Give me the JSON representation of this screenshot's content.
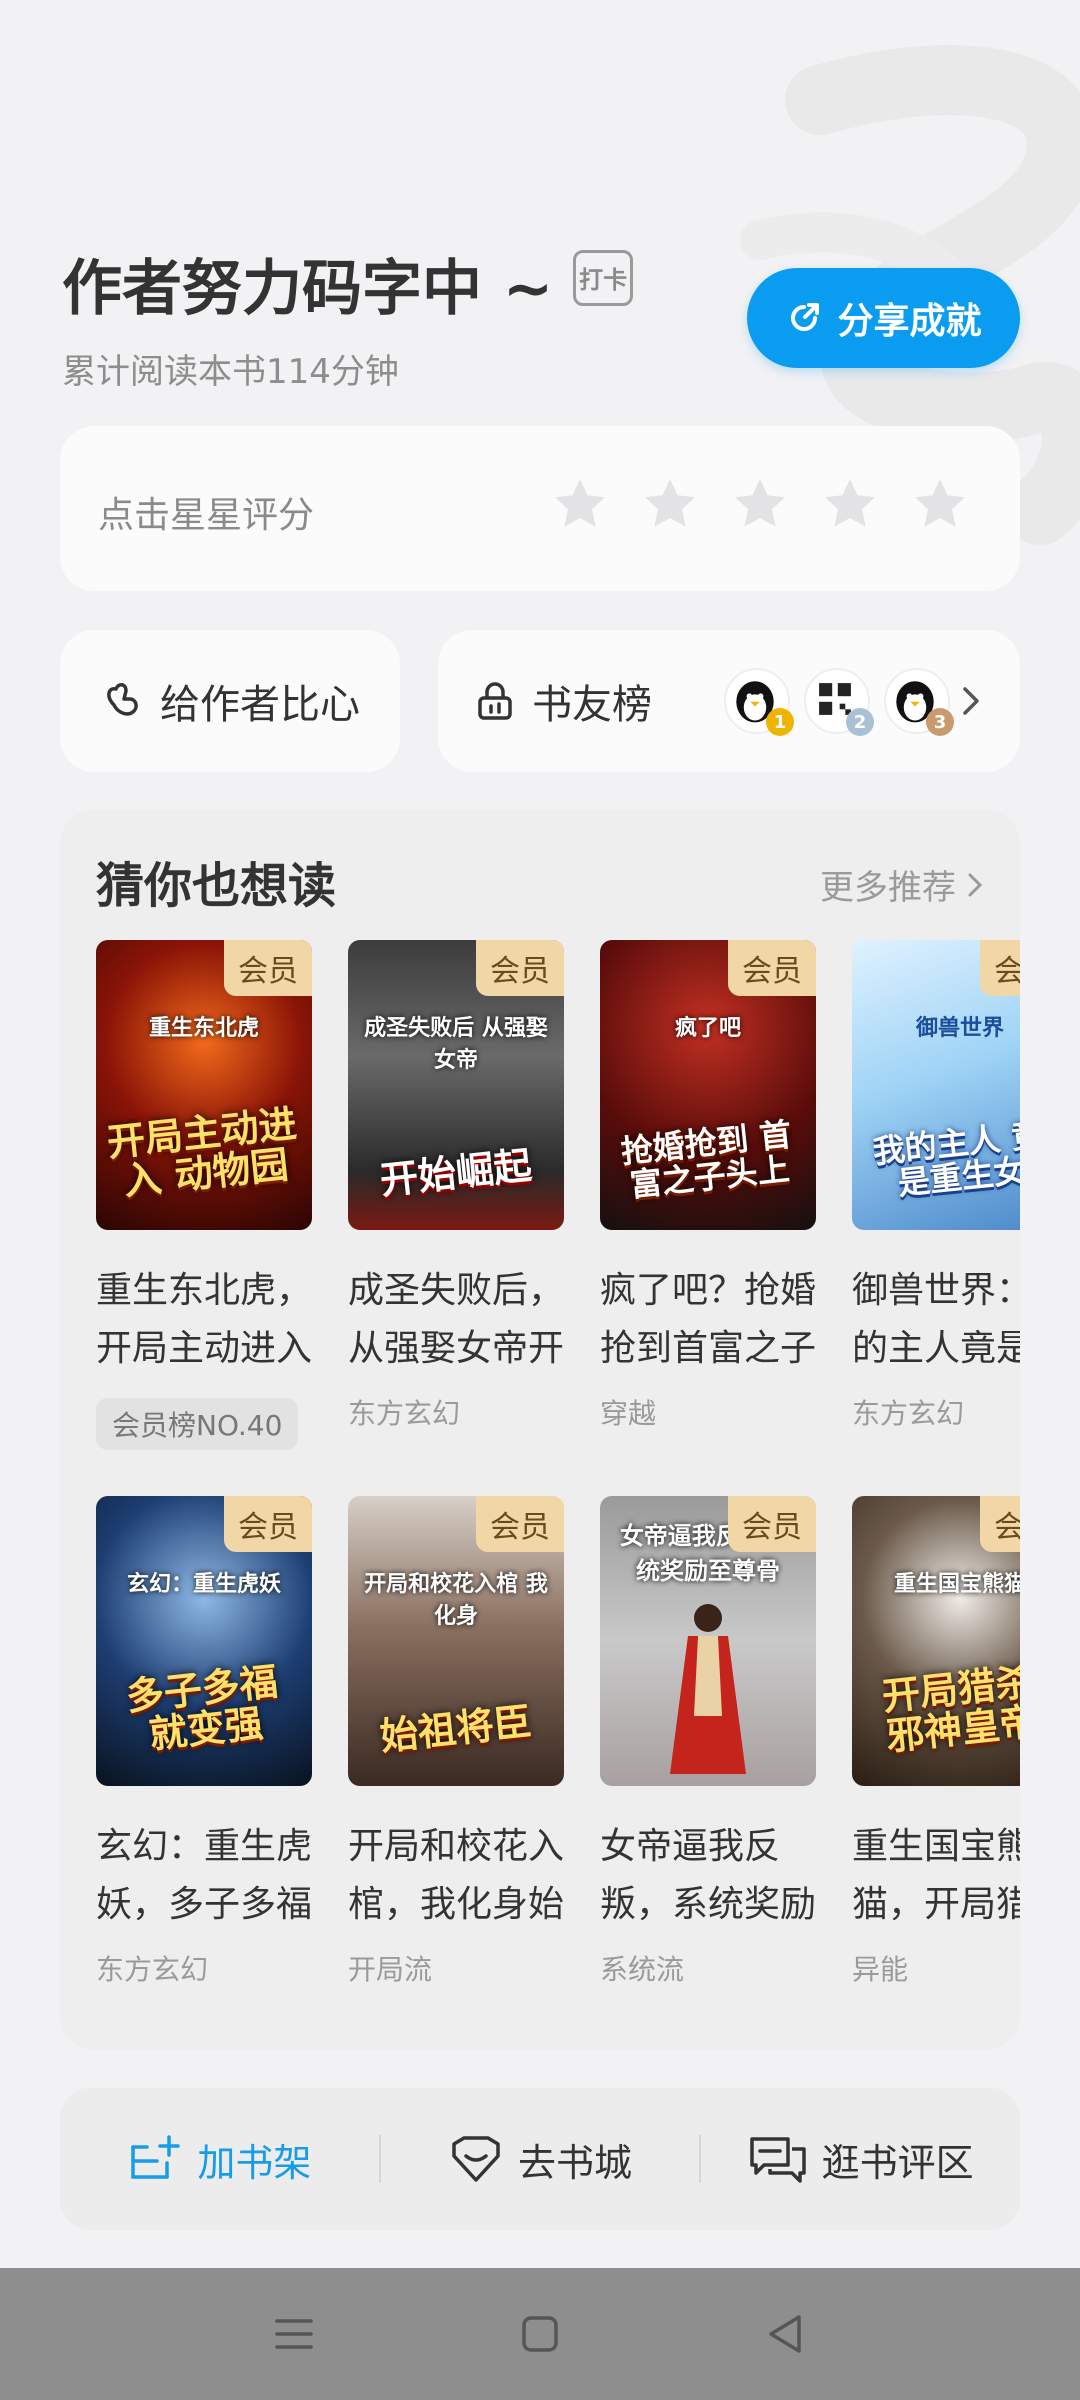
{
  "header": {
    "title": "作者努力码字中 ~",
    "checkin_label": "打卡",
    "subtitle": "累计阅读本书114分钟",
    "share_label": "分享成就"
  },
  "rating": {
    "label": "点击星星评分",
    "stars": 5
  },
  "tip": {
    "label": "给作者比心"
  },
  "friends": {
    "label": "书友榜",
    "ranks": [
      "1",
      "2",
      "3"
    ]
  },
  "recommend": {
    "title": "猜你也想读",
    "more": "更多推荐",
    "vip_label": "会员",
    "books": [
      {
        "cover_title": "开局主动进入\n动物园",
        "cover_sub": "重生东北虎",
        "title": "重生东北虎，\n开局主动进入",
        "tag": "会员榜NO.40"
      },
      {
        "cover_title": "开始崛起",
        "cover_sub": "成圣失败后 从强娶女帝",
        "title": "成圣失败后，\n从强娶女帝开",
        "tag": "东方玄幻"
      },
      {
        "cover_title": "抢婚抢到\n首富之子头上",
        "cover_sub": "疯了吧",
        "title": "疯了吧？抢婚\n抢到首富之子",
        "tag": "穿越"
      },
      {
        "cover_title": "我的主人\n竟是重生女",
        "cover_sub": "御兽世界",
        "title": "御兽世界：\n的主人竟是",
        "tag": "东方玄幻"
      },
      {
        "cover_title": "多子多福\n就变强",
        "cover_sub": "玄幻：重生虎妖",
        "title": "玄幻：重生虎\n妖，多子多福",
        "tag": "东方玄幻"
      },
      {
        "cover_title": "始祖将臣",
        "cover_sub": "开局和校花入棺 我化身",
        "title": "开局和校花入\n棺，我化身始",
        "tag": "开局流"
      },
      {
        "cover_title": "",
        "cover_sub": "女帝逼我反叛 系统奖励至尊骨",
        "title": "女帝逼我反\n叛，系统奖励",
        "tag": "系统流"
      },
      {
        "cover_title": "开局猎杀\n邪神皇帝",
        "cover_sub": "重生国宝熊猫",
        "title": "重生国宝熊\n猫，开局猎",
        "tag": "异能"
      }
    ]
  },
  "bottom_bar": {
    "add_shelf": "加书架",
    "bookstore": "去书城",
    "comments": "逛书评区"
  },
  "colors": {
    "accent": "#0a9cf0",
    "active_text": "#169ce8",
    "vip_badge": "#f2d7a6"
  }
}
